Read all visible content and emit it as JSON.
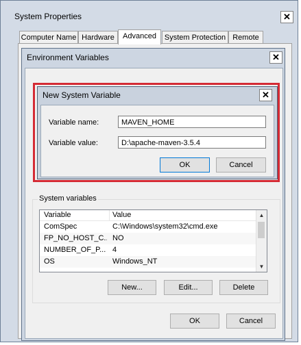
{
  "system_properties": {
    "title": "System Properties",
    "close": "✕",
    "tabs": [
      "Computer Name",
      "Hardware",
      "Advanced",
      "System Protection",
      "Remote"
    ]
  },
  "environment_variables": {
    "title": "Environment Variables",
    "close": "✕",
    "system_group_title": "System variables",
    "columns": [
      "Variable",
      "Value"
    ],
    "rows": [
      {
        "name": "ComSpec",
        "value": "C:\\Windows\\system32\\cmd.exe"
      },
      {
        "name": "FP_NO_HOST_C...",
        "value": "NO"
      },
      {
        "name": "NUMBER_OF_P...",
        "value": "4"
      },
      {
        "name": "OS",
        "value": "Windows_NT"
      }
    ],
    "buttons": {
      "new": "New...",
      "edit": "Edit...",
      "delete": "Delete",
      "ok": "OK",
      "cancel": "Cancel"
    }
  },
  "new_system_variable": {
    "title": "New System Variable",
    "close": "✕",
    "name_label": "Variable name:",
    "name_value": "MAVEN_HOME",
    "value_label": "Variable value:",
    "value_value": "D:\\apache-maven-3.5.4",
    "ok": "OK",
    "cancel": "Cancel"
  }
}
